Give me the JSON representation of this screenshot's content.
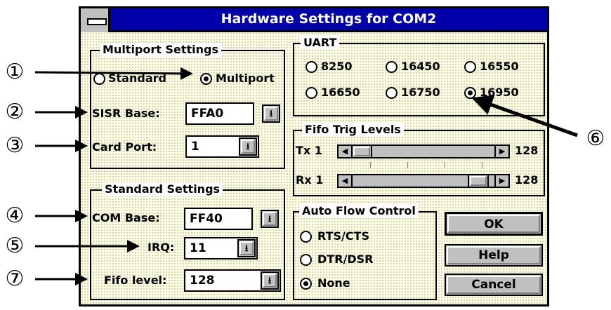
{
  "window": {
    "title": "Hardware Settings for COM2"
  },
  "multiport": {
    "title": "Multiport Settings",
    "standard_label": "Standard",
    "multiport_label": "Multiport",
    "selected": "Multiport",
    "sisr_label": "SISR Base:",
    "sisr_value": "FFA0",
    "card_port_label": "Card Port:",
    "card_port_value": "1"
  },
  "uart": {
    "title": "UART",
    "options": [
      "8250",
      "16450",
      "16550",
      "16650",
      "16750",
      "16950"
    ],
    "selected": "16950"
  },
  "fifo_trig": {
    "title": "Fifo Trig Levels",
    "tx": {
      "label": "Tx 1",
      "max_label": "128",
      "level_fraction": 0.0
    },
    "rx": {
      "label": "Rx 1",
      "max_label": "128",
      "level_fraction": 1.0
    }
  },
  "standard": {
    "title": "Standard Settings",
    "com_base_label": "COM Base:",
    "com_base_value": "FF40",
    "irq_label": "IRQ:",
    "irq_value": "11",
    "fifo_label": "Fifo level:",
    "fifo_value": "128"
  },
  "flow": {
    "title": "Auto Flow Control",
    "options": [
      "RTS/CTS",
      "DTR/DSR",
      "None"
    ],
    "selected": "None"
  },
  "buttons": {
    "ok": "OK",
    "help": "Help",
    "cancel": "Cancel"
  },
  "callouts": [
    "①",
    "②",
    "③",
    "④",
    "⑤",
    "⑦",
    "⑥"
  ],
  "icons": {
    "dropdown": "down-arrow-with-bar-icon",
    "scroll_left": "left-arrow-icon",
    "scroll_right": "right-arrow-icon",
    "system_menu": "system-menu-icon"
  },
  "colors": {
    "titlebar": "#0000a8",
    "client_bg": "#ffffe6",
    "button_face": "#c0c0c0"
  }
}
